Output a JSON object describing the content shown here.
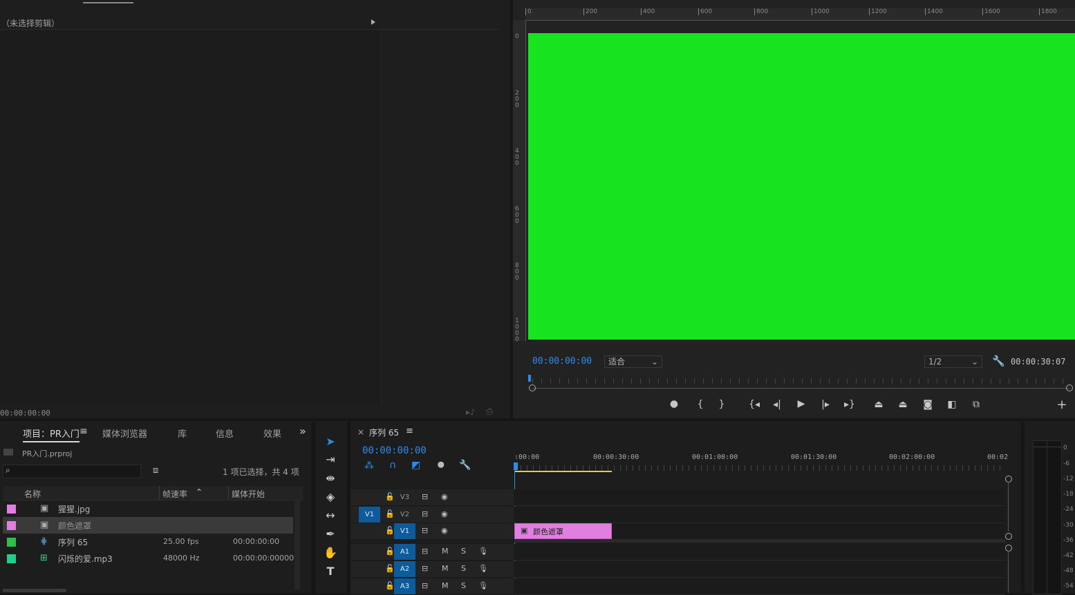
{
  "source_panel": {
    "no_clip_label": "（未选择剪辑）",
    "timecode": "00:00:00:00"
  },
  "program_monitor": {
    "ruler_top_ticks": [
      "0",
      "200",
      "400",
      "600",
      "800",
      "1000",
      "1200",
      "1400",
      "1600",
      "1800"
    ],
    "ruler_left_ticks": [
      "0",
      "200",
      "400",
      "600",
      "800",
      "1000"
    ],
    "frame_color": "#17e31f",
    "current_timecode": "00:00:00:00",
    "zoom": "适合",
    "resolution": "1/2",
    "duration": "00:00:30:07",
    "controls": [
      "marker-icon",
      "mark-in-icon",
      "mark-out-icon",
      "go-to-in-icon",
      "step-back-icon",
      "play-icon",
      "step-forward-icon",
      "go-to-out-icon",
      "lift-icon",
      "extract-icon",
      "export-frame-icon",
      "compare-icon",
      "insert-icon",
      "add-button-icon"
    ]
  },
  "project_panel": {
    "tabs": [
      {
        "label": "项目：PR入门",
        "active": true
      },
      {
        "label": "媒体浏览器"
      },
      {
        "label": "库"
      },
      {
        "label": "信息"
      },
      {
        "label": "效果"
      }
    ],
    "menu_glyph": "≡",
    "more_glyph": "»",
    "project_file": "PR入门.prproj",
    "selection_info": "1 项已选择，共 4 项",
    "columns": {
      "name": "名称",
      "fps": "帧速率",
      "start": "媒体开始"
    },
    "items": [
      {
        "color": "#e07fe0",
        "name": "猩猩.jpg",
        "fps": "",
        "start": "",
        "icon": "image-icon",
        "selected": false
      },
      {
        "color": "#e07fe0",
        "name": "颜色遮罩",
        "fps": "",
        "start": "",
        "icon": "image-icon",
        "selected": true
      },
      {
        "color": "#2fbf4a",
        "name": "序列 65",
        "fps": "25.00 fps",
        "start": "00:00:00:00",
        "icon": "sequence-icon",
        "selected": false
      },
      {
        "color": "#1fcf8a",
        "name": "闪烁的爱.mp3",
        "fps": "48000 Hz",
        "start": "00:00:00:00000",
        "icon": "audio-icon",
        "selected": false
      }
    ]
  },
  "tools": [
    "selection-tool-icon",
    "track-select-icon",
    "ripple-edit-icon",
    "razor-icon",
    "slip-icon",
    "pen-icon",
    "hand-icon",
    "type-icon"
  ],
  "timeline": {
    "close_glyph": "×",
    "sequence_name": "序列 65",
    "menu_glyph": "≡",
    "timecode": "00:00:00:00",
    "ruler_labels": [
      ":00:00",
      "00:00:30:00",
      "00:01:00:00",
      "00:01:30:00",
      "00:02:00:00",
      "00:02"
    ],
    "video_tracks": [
      {
        "label": "V3",
        "source": ""
      },
      {
        "label": "V2",
        "source": "V1"
      },
      {
        "label": "V1",
        "source": ""
      }
    ],
    "audio_tracks": [
      {
        "label": "A1",
        "m": "M",
        "s": "S"
      },
      {
        "label": "A2",
        "m": "M",
        "s": "S"
      },
      {
        "label": "A3",
        "m": "M",
        "s": "S"
      }
    ],
    "clip": {
      "name": "颜色遮罩",
      "color": "#e07fe0"
    }
  },
  "audio_meter": {
    "scale": [
      "0",
      "-6",
      "-12",
      "-18",
      "-24",
      "-30",
      "-36",
      "-42",
      "-48",
      "-54"
    ]
  }
}
